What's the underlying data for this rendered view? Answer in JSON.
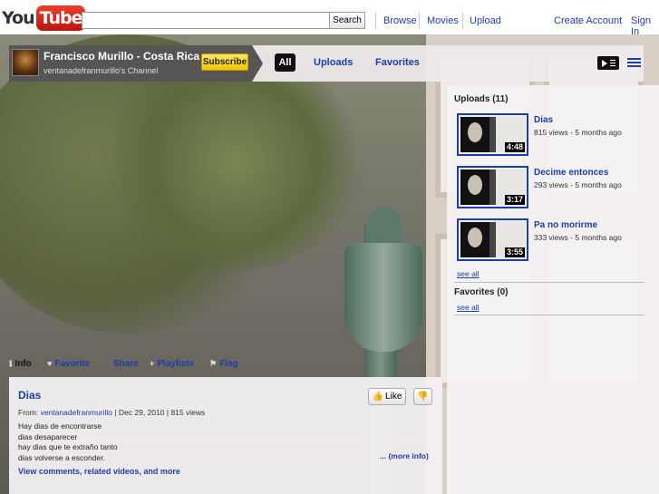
{
  "header": {
    "logo_you": "You",
    "logo_tube": "Tube",
    "search_button": "Search",
    "nav": [
      "Browse",
      "Movies",
      "Upload"
    ],
    "create_account": "Create Account",
    "sign_in": "Sign In"
  },
  "channel": {
    "name": "Francisco Murillo - Costa Rica",
    "subtitle": "ventanadefranmurillo's Channel",
    "subscribe_label": "Subscribe",
    "tabs": [
      "All",
      "Uploads",
      "Favorites"
    ]
  },
  "uploads": {
    "heading": "Uploads (11)",
    "videos": [
      {
        "title": "Dias",
        "meta": "815 views - 5 months ago",
        "duration": "4:48"
      },
      {
        "title": "Decime entonces",
        "meta": "293 views - 5 months ago",
        "duration": "3:17"
      },
      {
        "title": "Pa no morirme",
        "meta": "333 views - 5 months ago",
        "duration": "3:55"
      }
    ],
    "see_all": "see all"
  },
  "favorites": {
    "heading": "Favorites (0)",
    "see_all": "see all"
  },
  "info_tabs": [
    "Info",
    "Favorite",
    "Share",
    "Playlists",
    "Flag"
  ],
  "video": {
    "title": "Dias",
    "from_label": "From:",
    "author": "ventanadefranmurillo",
    "date": "Dec 29, 2010",
    "views": "815 views",
    "like_label": "Like",
    "description": [
      "Hay dias de encontrarse",
      "dias desaparecer",
      "hay dias que te extraño tanto",
      "dias volverse a esconder."
    ],
    "more_info": "... (more info)",
    "comments_link": "View comments, related videos, and more"
  },
  "colors": {
    "link": "#1c3ea5",
    "subscribe": "#f6c600",
    "logo_red": "#d0261a"
  }
}
